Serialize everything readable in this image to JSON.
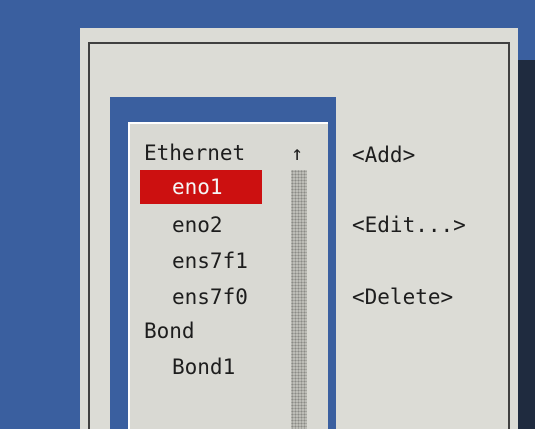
{
  "connections": {
    "groups": [
      {
        "label": "Ethernet",
        "items": [
          "eno1",
          "eno2",
          "ens7f1",
          "ens7f0"
        ]
      },
      {
        "label": "Bond",
        "items": [
          "Bond1"
        ]
      }
    ],
    "selected": "eno1"
  },
  "scrollbar": {
    "up_arrow": "↑"
  },
  "actions": {
    "add": "<Add>",
    "edit": "<Edit...>",
    "delete": "<Delete>"
  },
  "colors": {
    "background": "#3a5f9f",
    "dialog": "#dcdcd6",
    "selection": "#cc1010"
  }
}
